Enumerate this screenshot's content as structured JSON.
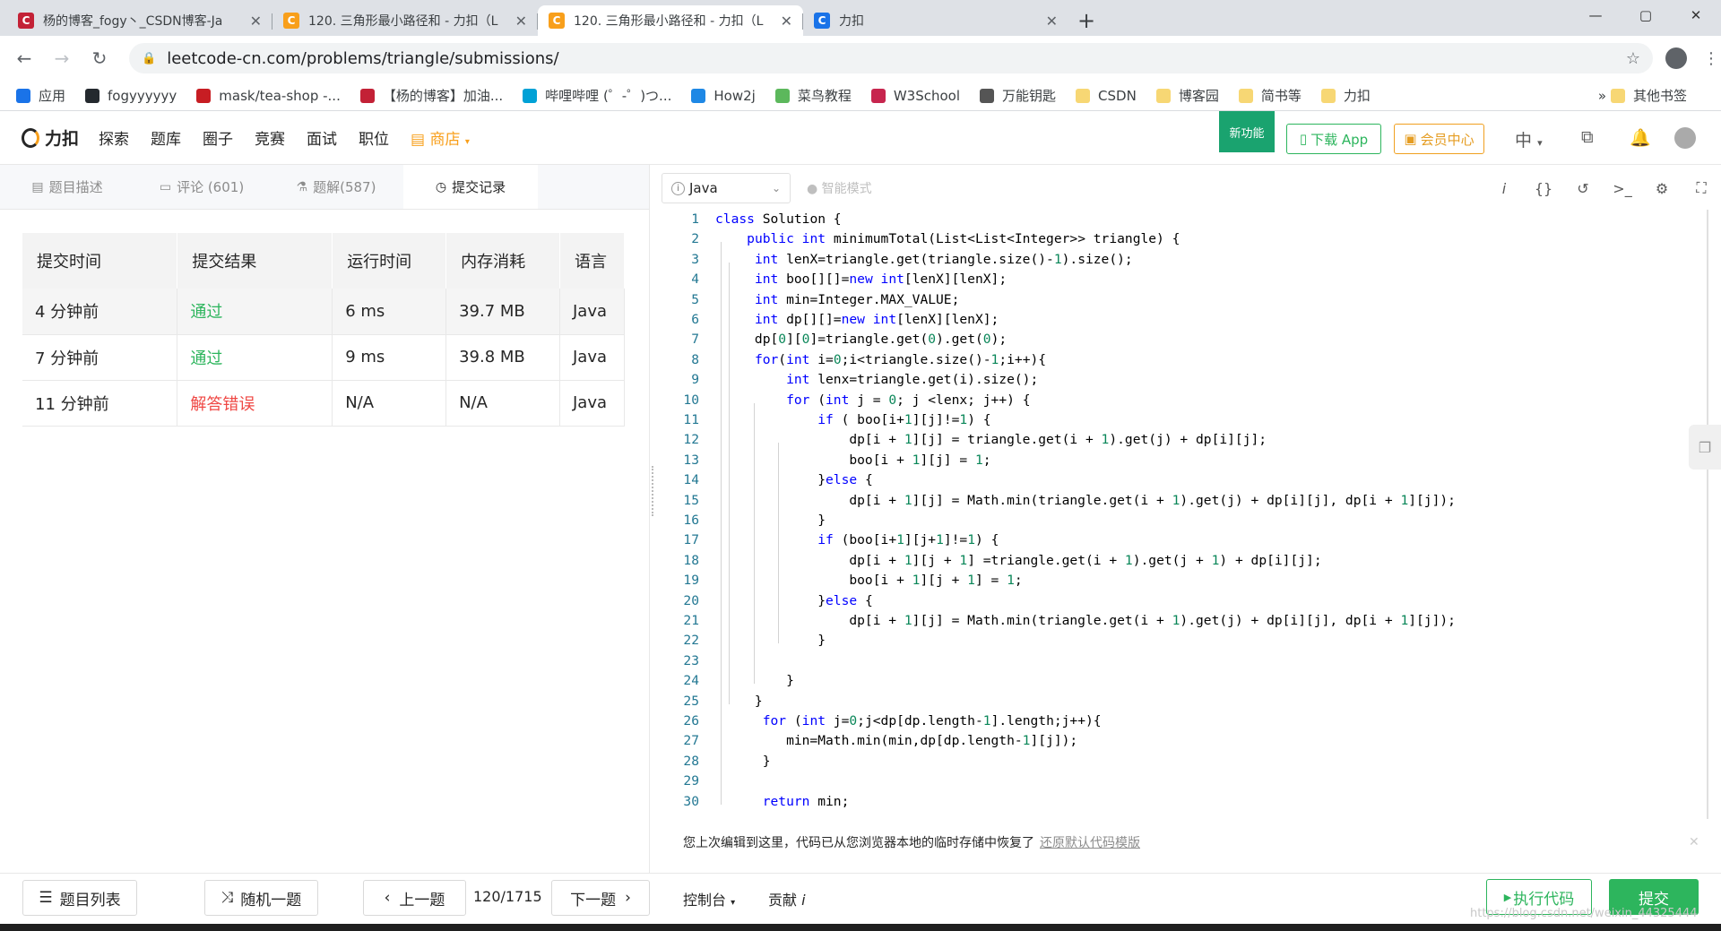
{
  "browser": {
    "tabs": [
      {
        "title": "杨的博客_fogy丶_CSDN博客-Ja",
        "favicon": "csdn-icon",
        "color": "#c32136",
        "glyph": "C"
      },
      {
        "title": "120. 三角形最小路径和 - 力扣（L",
        "favicon": "leetcode-icon",
        "color": "#f89f1b",
        "glyph": "C"
      },
      {
        "title": "120. 三角形最小路径和 - 力扣（L",
        "favicon": "leetcode-icon",
        "color": "#f89f1b",
        "glyph": "C"
      },
      {
        "title": "力扣",
        "favicon": "leetcode-icon",
        "color": "#1a73e8",
        "glyph": "C"
      }
    ],
    "url": "leetcode-cn.com/problems/triangle/submissions/",
    "bookmarks": [
      {
        "label": "应用",
        "color": "#1a73e8"
      },
      {
        "label": "fogyyyyyy",
        "color": "#24292e"
      },
      {
        "label": "mask/tea-shop -...",
        "color": "#c71d23"
      },
      {
        "label": "【杨的博客】加油...",
        "color": "#c32136"
      },
      {
        "label": "哔哩哔哩 (゜-゜)つ...",
        "color": "#00a1d6"
      },
      {
        "label": "How2j",
        "color": "#1e88e5"
      },
      {
        "label": "菜鸟教程",
        "color": "#5cb85c"
      },
      {
        "label": "W3School",
        "color": "#c7254e"
      },
      {
        "label": "万能钥匙",
        "color": "#555555"
      },
      {
        "label": "CSDN",
        "color": "#f7d774"
      },
      {
        "label": "博客园",
        "color": "#f7d774"
      },
      {
        "label": "简书等",
        "color": "#f7d774"
      },
      {
        "label": "力扣",
        "color": "#f7d774"
      }
    ],
    "bookmarks_more": "»",
    "other_bookmarks": "其他书签"
  },
  "header": {
    "logo": "力扣",
    "nav": [
      "探索",
      "题库",
      "圈子",
      "竞赛",
      "面试",
      "职位"
    ],
    "shop": "商店",
    "new_feature": "新功能",
    "download_app": "下载 App",
    "vip": "会员中心",
    "lang": "中"
  },
  "left_tabs": [
    {
      "label": "题目描述",
      "icon": "doc-icon"
    },
    {
      "label": "评论 (601)",
      "icon": "comment-icon"
    },
    {
      "label": "题解(587)",
      "icon": "flask-icon"
    },
    {
      "label": "提交记录",
      "icon": "clock-icon"
    }
  ],
  "submissions": {
    "headers": [
      "提交时间",
      "提交结果",
      "运行时间",
      "内存消耗",
      "语言"
    ],
    "rows": [
      {
        "time": "4 分钟前",
        "result": "通过",
        "status": "pass",
        "runtime": "6 ms",
        "memory": "39.7 MB",
        "lang": "Java"
      },
      {
        "time": "7 分钟前",
        "result": "通过",
        "status": "pass",
        "runtime": "9 ms",
        "memory": "39.8 MB",
        "lang": "Java"
      },
      {
        "time": "11 分钟前",
        "result": "解答错误",
        "status": "fail",
        "runtime": "N/A",
        "memory": "N/A",
        "lang": "Java"
      }
    ]
  },
  "editor": {
    "language": "Java",
    "smart_mode": "智能模式",
    "lines": [
      "class Solution {",
      "    public int minimumTotal(List<List<Integer>> triangle) {",
      "     int lenX=triangle.get(triangle.size()-1).size();",
      "     int boo[][]=new int[lenX][lenX];",
      "     int min=Integer.MAX_VALUE;",
      "     int dp[][]=new int[lenX][lenX];",
      "     dp[0][0]=triangle.get(0).get(0);",
      "     for(int i=0;i<triangle.size()-1;i++){",
      "         int lenx=triangle.get(i).size();",
      "         for (int j = 0; j <lenx; j++) {",
      "             if ( boo[i+1][j]!=1) {",
      "                 dp[i + 1][j] = triangle.get(i + 1).get(j) + dp[i][j];",
      "                 boo[i + 1][j] = 1;",
      "             }else {",
      "                 dp[i + 1][j] = Math.min(triangle.get(i + 1).get(j) + dp[i][j], dp[i + 1][j]);",
      "             }",
      "             if (boo[i+1][j+1]!=1) {",
      "                 dp[i + 1][j + 1] =triangle.get(i + 1).get(j + 1) + dp[i][j];",
      "                 boo[i + 1][j + 1] = 1;",
      "             }else {",
      "                 dp[i + 1][j] = Math.min(triangle.get(i + 1).get(j) + dp[i][j], dp[i + 1][j]);",
      "             }",
      "",
      "         }",
      "     }",
      "      for (int j=0;j<dp[dp.length-1].length;j++){",
      "         min=Math.min(min,dp[dp.length-1][j]);",
      "      }",
      "",
      "      return min;"
    ]
  },
  "notice": {
    "text": "您上次编辑到这里，代码已从您浏览器本地的临时存储中恢复了",
    "link": "还原默认代码模版"
  },
  "footer": {
    "problem_list": "题目列表",
    "random": "随机一题",
    "prev": "上一题",
    "pager": "120/1715",
    "next": "下一题",
    "console": "控制台",
    "contribute": "贡献",
    "run": "执行代码",
    "submit": "提交",
    "watermark": "https://blog.csdn.net/weixin_44325444"
  }
}
